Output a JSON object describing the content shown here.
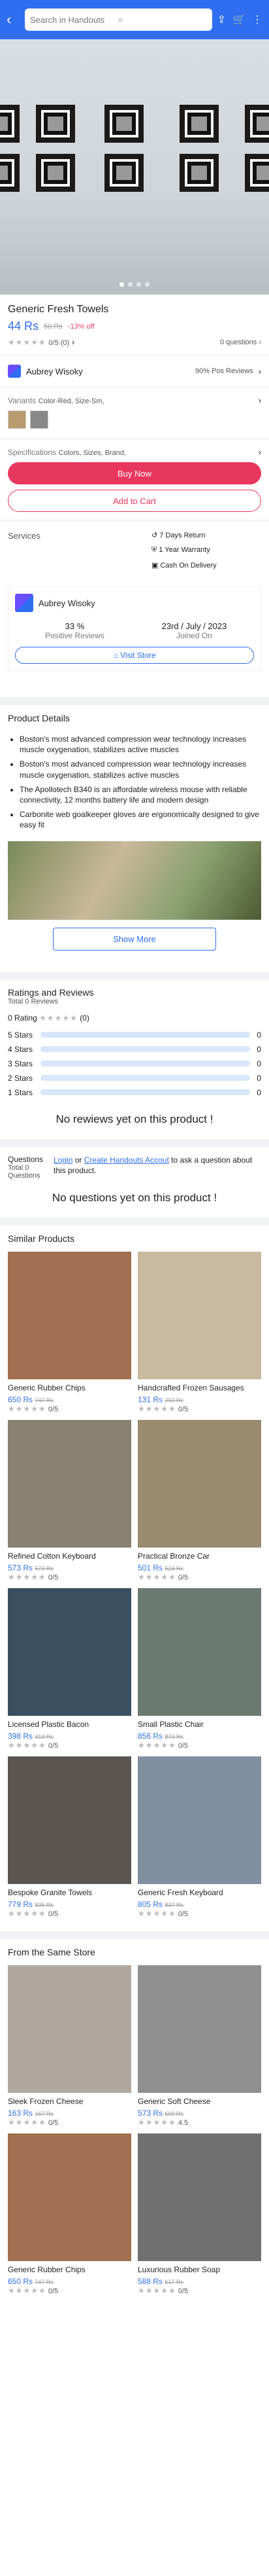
{
  "search": {
    "placeholder": "Search in Handouts"
  },
  "product": {
    "title": "Generic Fresh Towels",
    "price": "44 Rs",
    "old": "50 Rs",
    "discount": "-13% off",
    "rating_text": "0/5 (0)",
    "questions": "0 questions"
  },
  "seller": {
    "name": "Aubrey Wisoky",
    "reviews": "90% Pos Reviews"
  },
  "variants": {
    "label": "Variants",
    "values": "Color-Red, Size-Sm,"
  },
  "specs": {
    "label": "Specifications",
    "values": "Colors, Sizes, Brand,"
  },
  "actions": {
    "buy": "Buy Now",
    "cart": "Add to Cart"
  },
  "services": {
    "label": "Services",
    "items": [
      "7 Days Return",
      "1 Year Warranty",
      "Cash On Delivery"
    ]
  },
  "store": {
    "name": "Aubrey Wisoky",
    "pos": "33 %",
    "pos_label": "Positive Reviews",
    "joined": "23rd / July / 2023",
    "joined_label": "Joined On",
    "visit": "Visit Store"
  },
  "details": {
    "title": "Product Details",
    "bullets": [
      "Boston's most advanced compression wear technology increases muscle oxygenation, stabilizes active muscles",
      "Boston's most advanced compression wear technology increases muscle oxygenation, stabilizes active muscles",
      "The Apollotech B340 is an affordable wireless mouse with reliable connectivity, 12 months battery life and modern design",
      "Carbonite web goalkeeper gloves are ergonomically designed to give easy fit"
    ],
    "show_more": "Show More"
  },
  "reviews": {
    "title": "Ratings and Reviews",
    "total": "Total 0 Reviews",
    "rating": "0 Rating",
    "count": "(0)",
    "rows": [
      {
        "label": "5 Stars",
        "n": "0"
      },
      {
        "label": "4 Stars",
        "n": "0"
      },
      {
        "label": "3 Stars",
        "n": "0"
      },
      {
        "label": "2 Stars",
        "n": "0"
      },
      {
        "label": "1 Stars",
        "n": "0"
      }
    ],
    "none": "No rewiews yet on this product !"
  },
  "questions": {
    "title": "Questions",
    "total": "Total 0",
    "sub": "Questions",
    "login": "Login",
    "or": "or",
    "create": "Create Handouts Accout",
    "rest": "to ask a question about this product.",
    "none": "No questions yet on this product !"
  },
  "similar": {
    "title": "Similar Products",
    "items": [
      {
        "name": "Generic Rubber Chips",
        "price": "650 Rs",
        "old": "747 Rs",
        "rating": "0/5",
        "color": "#a07050"
      },
      {
        "name": "Handcrafted Frozen Sausages",
        "price": "131 Rs",
        "old": "202 Rs",
        "rating": "0/5",
        "color": "#c9b9a0"
      },
      {
        "name": "Refined Cotton Keyboard",
        "price": "573 Rs",
        "old": "573 Rs",
        "rating": "0/5",
        "color": "#8a8070"
      },
      {
        "name": "Practical Bronze Car",
        "price": "501 Rs",
        "old": "524 Rs",
        "rating": "0/5",
        "color": "#9a8a70"
      },
      {
        "name": "Licensed Plastic Bacon",
        "price": "398 Rs",
        "old": "413 Rs",
        "rating": "0/5",
        "color": "#3a5060"
      },
      {
        "name": "Small Plastic Chair",
        "price": "856 Rs",
        "old": "873 Rs",
        "rating": "0/5",
        "color": "#6a7a70"
      },
      {
        "name": "Bespoke Granite Towels",
        "price": "779 Rs",
        "old": "835 Rs",
        "rating": "0/5",
        "color": "#5a5550"
      },
      {
        "name": "Generic Fresh Keyboard",
        "price": "805 Rs",
        "old": "837 Rs",
        "rating": "0/5",
        "color": "#8090a0"
      }
    ]
  },
  "store_items": {
    "title": "From the Same Store",
    "items": [
      {
        "name": "Sleek Frozen Cheese",
        "price": "163 Rs",
        "old": "167 Rs",
        "rating": "0/5",
        "color": "#b0a8a0"
      },
      {
        "name": "Generic Soft Cheese",
        "price": "573 Rs",
        "old": "600 Rs",
        "rating": "4.5",
        "color": "#909090"
      },
      {
        "name": "Generic Rubber Chips",
        "price": "650 Rs",
        "old": "747 Rs",
        "rating": "0/5",
        "color": "#a07050"
      },
      {
        "name": "Luxurious Rubber Soap",
        "price": "588 Rs",
        "old": "617 Rs",
        "rating": "0/5",
        "color": "#707070"
      }
    ]
  }
}
